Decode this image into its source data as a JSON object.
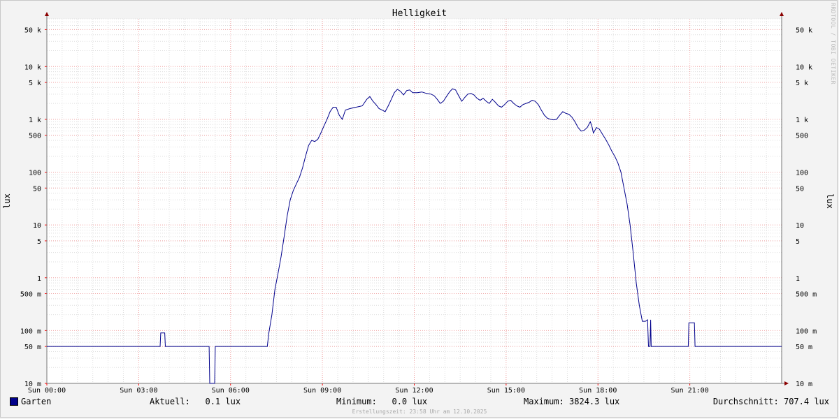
{
  "chart_data": {
    "type": "line",
    "title": "Helligkeit",
    "ylabel": "lux",
    "ylabel_right": "lux",
    "scale": "log",
    "ylim": [
      0.01,
      80000
    ],
    "x_ticks": [
      {
        "hour": 0,
        "label": "Sun 00:00"
      },
      {
        "hour": 3,
        "label": "Sun 03:00"
      },
      {
        "hour": 6,
        "label": "Sun 06:00"
      },
      {
        "hour": 9,
        "label": "Sun 09:00"
      },
      {
        "hour": 12,
        "label": "Sun 12:00"
      },
      {
        "hour": 15,
        "label": "Sun 15:00"
      },
      {
        "hour": 18,
        "label": "Sun 18:00"
      },
      {
        "hour": 21,
        "label": "Sun 21:00"
      }
    ],
    "y_ticks": [
      {
        "value": 0.01,
        "label": "10 m"
      },
      {
        "value": 0.05,
        "label": "50 m"
      },
      {
        "value": 0.1,
        "label": "100 m"
      },
      {
        "value": 0.5,
        "label": "500 m"
      },
      {
        "value": 1,
        "label": "1"
      },
      {
        "value": 5,
        "label": "5"
      },
      {
        "value": 10,
        "label": "10"
      },
      {
        "value": 50,
        "label": "50"
      },
      {
        "value": 100,
        "label": "100"
      },
      {
        "value": 500,
        "label": "500"
      },
      {
        "value": 1000,
        "label": "1 k"
      },
      {
        "value": 5000,
        "label": "5 k"
      },
      {
        "value": 10000,
        "label": "10 k"
      },
      {
        "value": 50000,
        "label": "50 k"
      }
    ],
    "grid": true,
    "series": [
      {
        "name": "Garten",
        "color": "#00008b",
        "points": [
          [
            0,
            0.05
          ],
          [
            3.7,
            0.05
          ],
          [
            3.72,
            0.09
          ],
          [
            3.85,
            0.09
          ],
          [
            3.87,
            0.05
          ],
          [
            5.3,
            0.05
          ],
          [
            5.32,
            0.01
          ],
          [
            5.48,
            0.01
          ],
          [
            5.5,
            0.05
          ],
          [
            7.2,
            0.05
          ],
          [
            7.25,
            0.09
          ],
          [
            7.35,
            0.2
          ],
          [
            7.45,
            0.6
          ],
          [
            7.55,
            1.2
          ],
          [
            7.65,
            2.5
          ],
          [
            7.75,
            6
          ],
          [
            7.85,
            15
          ],
          [
            7.95,
            30
          ],
          [
            8.05,
            45
          ],
          [
            8.15,
            60
          ],
          [
            8.25,
            80
          ],
          [
            8.35,
            120
          ],
          [
            8.45,
            200
          ],
          [
            8.55,
            320
          ],
          [
            8.65,
            400
          ],
          [
            8.75,
            380
          ],
          [
            8.85,
            420
          ],
          [
            8.95,
            550
          ],
          [
            9.05,
            750
          ],
          [
            9.15,
            1000
          ],
          [
            9.25,
            1400
          ],
          [
            9.35,
            1700
          ],
          [
            9.45,
            1700
          ],
          [
            9.55,
            1200
          ],
          [
            9.65,
            1000
          ],
          [
            9.75,
            1500
          ],
          [
            9.9,
            1600
          ],
          [
            10.1,
            1700
          ],
          [
            10.3,
            1800
          ],
          [
            10.45,
            2400
          ],
          [
            10.55,
            2700
          ],
          [
            10.65,
            2200
          ],
          [
            10.75,
            1900
          ],
          [
            10.85,
            1600
          ],
          [
            10.95,
            1500
          ],
          [
            11.05,
            1400
          ],
          [
            11.15,
            1800
          ],
          [
            11.25,
            2400
          ],
          [
            11.35,
            3200
          ],
          [
            11.45,
            3700
          ],
          [
            11.55,
            3400
          ],
          [
            11.65,
            2900
          ],
          [
            11.75,
            3500
          ],
          [
            11.85,
            3600
          ],
          [
            11.95,
            3200
          ],
          [
            12.1,
            3200
          ],
          [
            12.25,
            3300
          ],
          [
            12.4,
            3100
          ],
          [
            12.55,
            3000
          ],
          [
            12.65,
            2800
          ],
          [
            12.75,
            2400
          ],
          [
            12.85,
            2000
          ],
          [
            12.95,
            2200
          ],
          [
            13.05,
            2700
          ],
          [
            13.15,
            3300
          ],
          [
            13.25,
            3800
          ],
          [
            13.35,
            3600
          ],
          [
            13.45,
            2800
          ],
          [
            13.55,
            2200
          ],
          [
            13.65,
            2600
          ],
          [
            13.75,
            3000
          ],
          [
            13.85,
            3100
          ],
          [
            13.95,
            2900
          ],
          [
            14.05,
            2500
          ],
          [
            14.15,
            2300
          ],
          [
            14.25,
            2500
          ],
          [
            14.35,
            2200
          ],
          [
            14.45,
            2000
          ],
          [
            14.55,
            2400
          ],
          [
            14.65,
            2100
          ],
          [
            14.75,
            1800
          ],
          [
            14.85,
            1700
          ],
          [
            14.95,
            1900
          ],
          [
            15.05,
            2200
          ],
          [
            15.15,
            2300
          ],
          [
            15.25,
            2000
          ],
          [
            15.35,
            1800
          ],
          [
            15.45,
            1700
          ],
          [
            15.55,
            1900
          ],
          [
            15.65,
            2000
          ],
          [
            15.75,
            2100
          ],
          [
            15.85,
            2300
          ],
          [
            15.95,
            2200
          ],
          [
            16.05,
            1900
          ],
          [
            16.15,
            1500
          ],
          [
            16.25,
            1200
          ],
          [
            16.35,
            1050
          ],
          [
            16.45,
            1000
          ],
          [
            16.55,
            980
          ],
          [
            16.65,
            1000
          ],
          [
            16.75,
            1200
          ],
          [
            16.85,
            1400
          ],
          [
            16.95,
            1300
          ],
          [
            17.05,
            1250
          ],
          [
            17.15,
            1100
          ],
          [
            17.25,
            900
          ],
          [
            17.35,
            700
          ],
          [
            17.45,
            600
          ],
          [
            17.55,
            620
          ],
          [
            17.65,
            700
          ],
          [
            17.75,
            900
          ],
          [
            17.8,
            750
          ],
          [
            17.85,
            550
          ],
          [
            17.95,
            700
          ],
          [
            18.05,
            650
          ],
          [
            18.15,
            520
          ],
          [
            18.25,
            420
          ],
          [
            18.35,
            330
          ],
          [
            18.45,
            250
          ],
          [
            18.55,
            200
          ],
          [
            18.65,
            150
          ],
          [
            18.75,
            100
          ],
          [
            18.85,
            50
          ],
          [
            18.95,
            25
          ],
          [
            19.05,
            10
          ],
          [
            19.15,
            3
          ],
          [
            19.25,
            0.8
          ],
          [
            19.35,
            0.3
          ],
          [
            19.45,
            0.15
          ],
          [
            19.55,
            0.15
          ],
          [
            19.62,
            0.16
          ],
          [
            19.65,
            0.05
          ],
          [
            19.7,
            0.05
          ],
          [
            19.72,
            0.16
          ],
          [
            19.74,
            0.05
          ],
          [
            20.95,
            0.05
          ],
          [
            20.97,
            0.14
          ],
          [
            21.15,
            0.14
          ],
          [
            21.17,
            0.05
          ],
          [
            24,
            0.05
          ]
        ]
      }
    ]
  },
  "watermark": "RRDTOOL / TOBI OETIKER",
  "legend": {
    "series_name": "Garten",
    "aktuell": "Aktuell:   0.1 lux",
    "minimum": "Minimum:   0.0 lux",
    "maximum": "Maximum: 3824.3 lux",
    "durchschnitt": "Durchschnitt: 707.4 lux"
  },
  "footer": "Erstellungszeit: 23:58 Uhr am 12.10.2025"
}
